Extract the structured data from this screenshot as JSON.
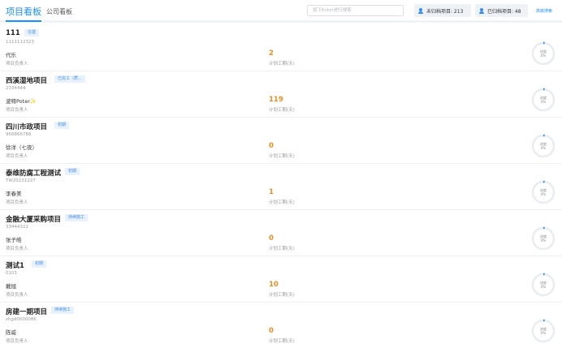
{
  "header": {
    "tab_project": "项目看板",
    "tab_company": "公司看板",
    "search_placeholder": "按下Enter进行搜索",
    "unfiled_label": "未归档项目: 213",
    "filed_label": "已归档项目: 48",
    "advanced_search": "高级搜索"
  },
  "colors": {
    "accent": "#1890ff",
    "duration": "#f08c1f",
    "tag_bg": "#e8f1ff",
    "progress_track": "#e9ecf0"
  },
  "projects": [
    {
      "name": "111",
      "tag": "在建",
      "code": "1111112323",
      "owner": "代乐",
      "owner_label": "项目负责人",
      "duration": "2",
      "duration_label": "计划工期(天)",
      "progress_label": "进度",
      "progress_value": "0%"
    },
    {
      "name": "西溪湿地项目",
      "tag": "已完工（质...",
      "code": "2334444",
      "owner": "波特Poter✨",
      "owner_label": "项目负责人",
      "duration": "119",
      "duration_label": "计划工期(天)",
      "progress_label": "进度",
      "progress_value": "0%"
    },
    {
      "name": "四川市政项目",
      "tag": "初期",
      "code": "966866766",
      "owner": "徐洋（七夜）",
      "owner_label": "项目负责人",
      "duration": "0",
      "duration_label": "计划工期(天)",
      "progress_label": "进度",
      "progress_value": "0%"
    },
    {
      "name": "泰维防腐工程测试",
      "tag": "初期",
      "code": "TW20231227",
      "owner": "李春美",
      "owner_label": "项目负责人",
      "duration": "1",
      "duration_label": "计划工期(天)",
      "progress_label": "进度",
      "progress_value": "0%"
    },
    {
      "name": "金融大厦采购项目",
      "tag": "持续施工",
      "code": "33444322",
      "owner": "张子皓",
      "owner_label": "项目负责人",
      "duration": "0",
      "duration_label": "计划工期(天)",
      "progress_label": "进度",
      "progress_value": "0%"
    },
    {
      "name": "测试1",
      "tag": "初期",
      "code": "0101",
      "owner": "戴旭",
      "owner_label": "项目负责人",
      "duration": "10",
      "duration_label": "计划工期(天)",
      "progress_label": "进度",
      "progress_value": "0%"
    },
    {
      "name": "房建一期项目",
      "tag": "持续施工",
      "code": "zhgd0000086",
      "owner": "陈威",
      "owner_label": "项目负责人",
      "duration": "0",
      "duration_label": "计划工期(天)",
      "progress_label": "进度",
      "progress_value": "0%"
    }
  ]
}
